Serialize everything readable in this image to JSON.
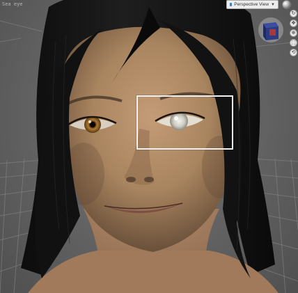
{
  "viewport": {
    "camera_label": "Sea eye",
    "view_selector": {
      "label": "Perspective View",
      "icon": "camera-icon"
    },
    "render_sphere_icon": "preview-sphere-icon",
    "orientation_cube_icon": "view-cube-icon",
    "nav_tools": [
      {
        "icon": "rotate-icon",
        "glyph": "↻"
      },
      {
        "icon": "pan-icon",
        "glyph": "✥"
      },
      {
        "icon": "zoom-icon",
        "glyph": "⊕"
      },
      {
        "icon": "frame-icon",
        "glyph": "⬚"
      },
      {
        "icon": "reset-icon",
        "glyph": "⟲"
      }
    ]
  },
  "colors": {
    "background": "#666666",
    "selection_box": "#f2f2f2",
    "hair": "#161616",
    "skin": "#b5906b",
    "iris_left": "#9a6a2a",
    "iris_right": "#c8c6bd"
  }
}
